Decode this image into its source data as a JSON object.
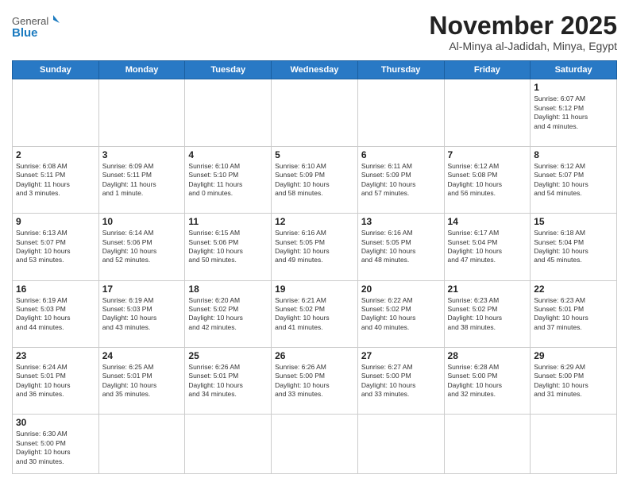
{
  "header": {
    "logo_general": "General",
    "logo_blue": "Blue",
    "month": "November 2025",
    "location": "Al-Minya al-Jadidah, Minya, Egypt"
  },
  "days_of_week": [
    "Sunday",
    "Monday",
    "Tuesday",
    "Wednesday",
    "Thursday",
    "Friday",
    "Saturday"
  ],
  "weeks": [
    [
      {
        "day": "",
        "info": ""
      },
      {
        "day": "",
        "info": ""
      },
      {
        "day": "",
        "info": ""
      },
      {
        "day": "",
        "info": ""
      },
      {
        "day": "",
        "info": ""
      },
      {
        "day": "",
        "info": ""
      },
      {
        "day": "1",
        "info": "Sunrise: 6:07 AM\nSunset: 5:12 PM\nDaylight: 11 hours\nand 4 minutes."
      }
    ],
    [
      {
        "day": "2",
        "info": "Sunrise: 6:08 AM\nSunset: 5:11 PM\nDaylight: 11 hours\nand 3 minutes."
      },
      {
        "day": "3",
        "info": "Sunrise: 6:09 AM\nSunset: 5:11 PM\nDaylight: 11 hours\nand 1 minute."
      },
      {
        "day": "4",
        "info": "Sunrise: 6:10 AM\nSunset: 5:10 PM\nDaylight: 11 hours\nand 0 minutes."
      },
      {
        "day": "5",
        "info": "Sunrise: 6:10 AM\nSunset: 5:09 PM\nDaylight: 10 hours\nand 58 minutes."
      },
      {
        "day": "6",
        "info": "Sunrise: 6:11 AM\nSunset: 5:09 PM\nDaylight: 10 hours\nand 57 minutes."
      },
      {
        "day": "7",
        "info": "Sunrise: 6:12 AM\nSunset: 5:08 PM\nDaylight: 10 hours\nand 56 minutes."
      },
      {
        "day": "8",
        "info": "Sunrise: 6:12 AM\nSunset: 5:07 PM\nDaylight: 10 hours\nand 54 minutes."
      }
    ],
    [
      {
        "day": "9",
        "info": "Sunrise: 6:13 AM\nSunset: 5:07 PM\nDaylight: 10 hours\nand 53 minutes."
      },
      {
        "day": "10",
        "info": "Sunrise: 6:14 AM\nSunset: 5:06 PM\nDaylight: 10 hours\nand 52 minutes."
      },
      {
        "day": "11",
        "info": "Sunrise: 6:15 AM\nSunset: 5:06 PM\nDaylight: 10 hours\nand 50 minutes."
      },
      {
        "day": "12",
        "info": "Sunrise: 6:16 AM\nSunset: 5:05 PM\nDaylight: 10 hours\nand 49 minutes."
      },
      {
        "day": "13",
        "info": "Sunrise: 6:16 AM\nSunset: 5:05 PM\nDaylight: 10 hours\nand 48 minutes."
      },
      {
        "day": "14",
        "info": "Sunrise: 6:17 AM\nSunset: 5:04 PM\nDaylight: 10 hours\nand 47 minutes."
      },
      {
        "day": "15",
        "info": "Sunrise: 6:18 AM\nSunset: 5:04 PM\nDaylight: 10 hours\nand 45 minutes."
      }
    ],
    [
      {
        "day": "16",
        "info": "Sunrise: 6:19 AM\nSunset: 5:03 PM\nDaylight: 10 hours\nand 44 minutes."
      },
      {
        "day": "17",
        "info": "Sunrise: 6:19 AM\nSunset: 5:03 PM\nDaylight: 10 hours\nand 43 minutes."
      },
      {
        "day": "18",
        "info": "Sunrise: 6:20 AM\nSunset: 5:02 PM\nDaylight: 10 hours\nand 42 minutes."
      },
      {
        "day": "19",
        "info": "Sunrise: 6:21 AM\nSunset: 5:02 PM\nDaylight: 10 hours\nand 41 minutes."
      },
      {
        "day": "20",
        "info": "Sunrise: 6:22 AM\nSunset: 5:02 PM\nDaylight: 10 hours\nand 40 minutes."
      },
      {
        "day": "21",
        "info": "Sunrise: 6:23 AM\nSunset: 5:02 PM\nDaylight: 10 hours\nand 38 minutes."
      },
      {
        "day": "22",
        "info": "Sunrise: 6:23 AM\nSunset: 5:01 PM\nDaylight: 10 hours\nand 37 minutes."
      }
    ],
    [
      {
        "day": "23",
        "info": "Sunrise: 6:24 AM\nSunset: 5:01 PM\nDaylight: 10 hours\nand 36 minutes."
      },
      {
        "day": "24",
        "info": "Sunrise: 6:25 AM\nSunset: 5:01 PM\nDaylight: 10 hours\nand 35 minutes."
      },
      {
        "day": "25",
        "info": "Sunrise: 6:26 AM\nSunset: 5:01 PM\nDaylight: 10 hours\nand 34 minutes."
      },
      {
        "day": "26",
        "info": "Sunrise: 6:26 AM\nSunset: 5:00 PM\nDaylight: 10 hours\nand 33 minutes."
      },
      {
        "day": "27",
        "info": "Sunrise: 6:27 AM\nSunset: 5:00 PM\nDaylight: 10 hours\nand 33 minutes."
      },
      {
        "day": "28",
        "info": "Sunrise: 6:28 AM\nSunset: 5:00 PM\nDaylight: 10 hours\nand 32 minutes."
      },
      {
        "day": "29",
        "info": "Sunrise: 6:29 AM\nSunset: 5:00 PM\nDaylight: 10 hours\nand 31 minutes."
      }
    ],
    [
      {
        "day": "30",
        "info": "Sunrise: 6:30 AM\nSunset: 5:00 PM\nDaylight: 10 hours\nand 30 minutes."
      },
      {
        "day": "",
        "info": ""
      },
      {
        "day": "",
        "info": ""
      },
      {
        "day": "",
        "info": ""
      },
      {
        "day": "",
        "info": ""
      },
      {
        "day": "",
        "info": ""
      },
      {
        "day": "",
        "info": ""
      }
    ]
  ]
}
